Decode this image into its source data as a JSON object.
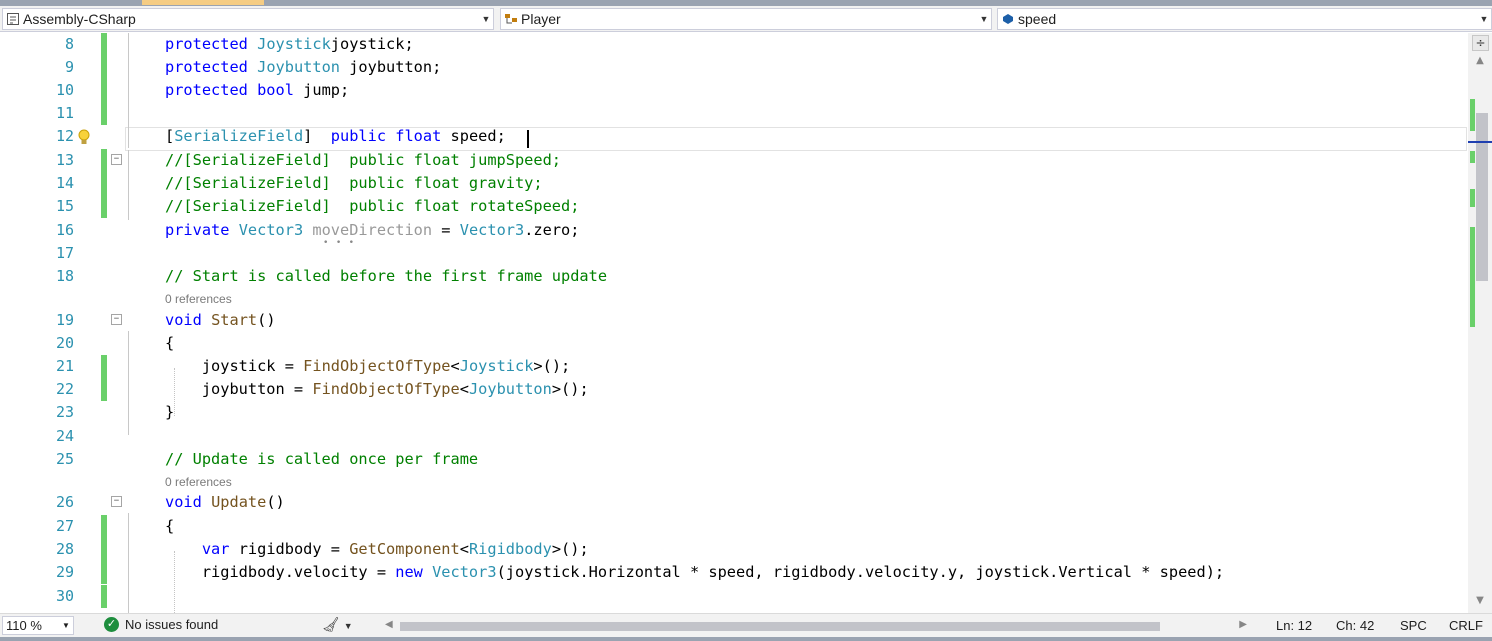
{
  "navbar": {
    "project": "Assembly-CSharp",
    "type": "Player",
    "member": "speed"
  },
  "editor": {
    "lines": [
      {
        "n": "8",
        "tokens": [
          [
            "kw",
            "protected "
          ],
          [
            "ty",
            "Joystick"
          ],
          [
            "",
            "joystick;"
          ]
        ]
      },
      {
        "n": "9",
        "tokens": [
          [
            "kw",
            "protected "
          ],
          [
            "ty",
            "Joybutton"
          ],
          [
            "",
            " joybutton;"
          ]
        ]
      },
      {
        "n": "10",
        "tokens": [
          [
            "kw",
            "protected bool"
          ],
          [
            "",
            " jump;"
          ]
        ]
      },
      {
        "n": "11",
        "tokens": []
      },
      {
        "n": "12",
        "tokens": [
          [
            "",
            "["
          ],
          [
            "ty",
            "SerializeField"
          ],
          [
            "",
            "]  "
          ],
          [
            "kw",
            "public float"
          ],
          [
            "",
            " speed;"
          ]
        ]
      },
      {
        "n": "13",
        "tokens": [
          [
            "cm",
            "//[SerializeField]  public float jumpSpeed;"
          ]
        ]
      },
      {
        "n": "14",
        "tokens": [
          [
            "cm",
            "//[SerializeField]  public float gravity;"
          ]
        ]
      },
      {
        "n": "15",
        "tokens": [
          [
            "cm",
            "//[SerializeField]  public float rotateSpeed;"
          ]
        ]
      },
      {
        "n": "16",
        "tokens": [
          [
            "kw",
            "private "
          ],
          [
            "ty",
            "Vector3"
          ],
          [
            "fade",
            " moveDirection"
          ],
          [
            "",
            " = "
          ],
          [
            "ty",
            "Vector3"
          ],
          [
            "",
            ".zero;"
          ]
        ]
      },
      {
        "n": "17",
        "tokens": []
      },
      {
        "n": "18",
        "tokens": [
          [
            "cm",
            "// Start is called before the first frame update"
          ]
        ]
      },
      {
        "n": "19",
        "tokens": [
          [
            "kw",
            "void "
          ],
          [
            "fn",
            "Start"
          ],
          [
            "",
            "()"
          ]
        ]
      },
      {
        "n": "20",
        "tokens": [
          [
            "",
            "{"
          ]
        ]
      },
      {
        "n": "21",
        "tokens": [
          [
            "",
            "    joystick = "
          ],
          [
            "fn",
            "FindObjectOfType"
          ],
          [
            "",
            "<"
          ],
          [
            "ty",
            "Joystick"
          ],
          [
            "",
            ">();"
          ]
        ]
      },
      {
        "n": "22",
        "tokens": [
          [
            "",
            "    joybutton = "
          ],
          [
            "fn",
            "FindObjectOfType"
          ],
          [
            "",
            "<"
          ],
          [
            "ty",
            "Joybutton"
          ],
          [
            "",
            ">();"
          ]
        ]
      },
      {
        "n": "23",
        "tokens": [
          [
            "",
            "}"
          ]
        ]
      },
      {
        "n": "24",
        "tokens": []
      },
      {
        "n": "25",
        "tokens": [
          [
            "cm",
            "// Update is called once per frame"
          ]
        ]
      },
      {
        "n": "26",
        "tokens": [
          [
            "kw",
            "void "
          ],
          [
            "fn",
            "Update"
          ],
          [
            "",
            "()"
          ]
        ]
      },
      {
        "n": "27",
        "tokens": [
          [
            "",
            "{"
          ]
        ]
      },
      {
        "n": "28",
        "tokens": [
          [
            "kw",
            "    var "
          ],
          [
            "",
            "rigidbody = "
          ],
          [
            "fn",
            "GetComponent"
          ],
          [
            "",
            "<"
          ],
          [
            "ty",
            "Rigidbody"
          ],
          [
            "",
            ">();"
          ]
        ]
      },
      {
        "n": "29",
        "tokens": [
          [
            "",
            "    rigidbody.velocity = "
          ],
          [
            "kw",
            "new "
          ],
          [
            "ty",
            "Vector3"
          ],
          [
            "",
            "(joystick.Horizontal * speed, rigidbody.velocity.y, joystick.Vertical * speed);"
          ]
        ]
      },
      {
        "n": "30",
        "tokens": []
      }
    ],
    "references_label": "0 references"
  },
  "status": {
    "zoom": "110 %",
    "issues": "No issues found",
    "line": "Ln: 12",
    "col": "Ch: 42",
    "indent": "SPC",
    "eol": "CRLF"
  },
  "colors": {
    "keyword": "#0000ff",
    "type": "#2b91af",
    "comment": "#008000",
    "method": "#74531f",
    "change_bar": "#6ad06a"
  }
}
